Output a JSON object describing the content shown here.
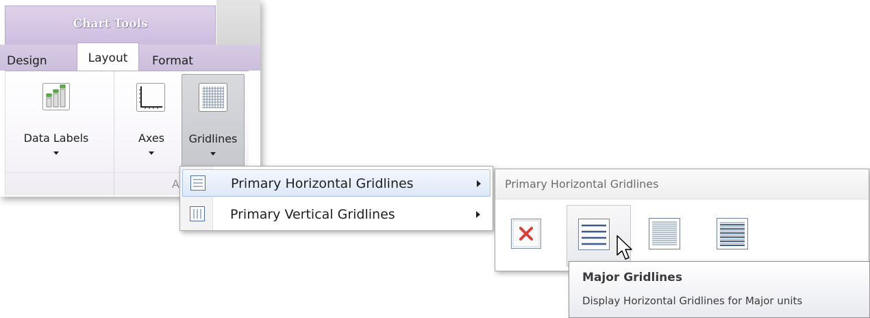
{
  "ribbon": {
    "context_title": "Chart Tools",
    "tabs": [
      {
        "label": "Design",
        "active": false
      },
      {
        "label": "Layout",
        "active": true
      },
      {
        "label": "Format",
        "active": false
      }
    ],
    "buttons": {
      "data_labels": "Data Labels",
      "axes": "Axes",
      "gridlines": "Gridlines"
    },
    "group_caption_partial": "A"
  },
  "menu": {
    "items": [
      {
        "label": "Primary Horizontal Gridlines",
        "icon": "horizontal-gridlines-icon",
        "highlighted": true
      },
      {
        "label": "Primary Vertical Gridlines",
        "icon": "vertical-gridlines-icon",
        "highlighted": false
      }
    ]
  },
  "gallery": {
    "title": "Primary Horizontal Gridlines",
    "items": [
      {
        "icon": "no-gridlines-icon"
      },
      {
        "icon": "major-gridlines-icon",
        "hovered": true
      },
      {
        "icon": "minor-gridlines-icon"
      },
      {
        "icon": "major-minor-gridlines-icon"
      }
    ]
  },
  "tooltip": {
    "title": "Major Gridlines",
    "text": "Display Horizontal Gridlines for Major units"
  },
  "colors": {
    "context_purple": "#cdbde0",
    "menu_highlight": "#dde8f8",
    "icon_blue": "#4a6ea5"
  }
}
